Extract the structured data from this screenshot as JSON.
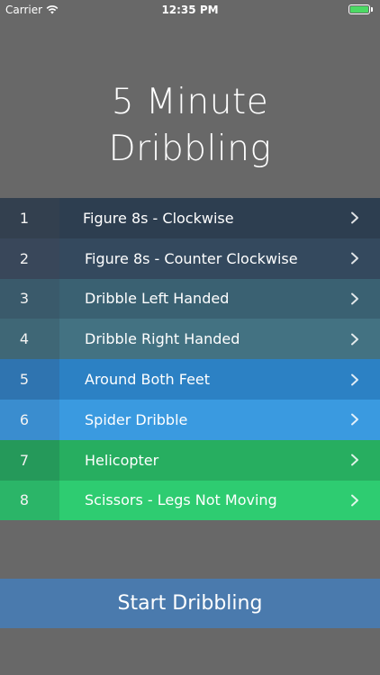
{
  "status_bar": {
    "carrier": "Carrier",
    "time": "12:35 PM",
    "battery_color": "#4cd964",
    "battery_level": 1.0
  },
  "title": {
    "line1": "5 Minute",
    "line2": "Dribbling"
  },
  "drills": [
    {
      "number": "1",
      "name": "Figure 8s - Clockwise",
      "num_bg": "#33404f",
      "row_bg": "#2d3e50"
    },
    {
      "number": "2",
      "name": "Figure 8s - Counter Clockwise",
      "num_bg": "#39475a",
      "row_bg": "#34495e"
    },
    {
      "number": "3",
      "name": "Dribble Left Handed",
      "num_bg": "#3a5a6b",
      "row_bg": "#3a6172"
    },
    {
      "number": "4",
      "name": "Dribble Right Handed",
      "num_bg": "#3f6776",
      "row_bg": "#437282"
    },
    {
      "number": "5",
      "name": "Around Both Feet",
      "num_bg": "#2f74b0",
      "row_bg": "#2c81c4"
    },
    {
      "number": "6",
      "name": "Spider Dribble",
      "num_bg": "#3a8dcf",
      "row_bg": "#3a9ae0"
    },
    {
      "number": "7",
      "name": "Helicopter",
      "num_bg": "#25995a",
      "row_bg": "#27ae60"
    },
    {
      "number": "8",
      "name": "Scissors - Legs Not Moving",
      "num_bg": "#2bb568",
      "row_bg": "#2ecc71"
    }
  ],
  "start_button": {
    "label": "Start Dribbling",
    "bg": "#4a7aad"
  },
  "colors": {
    "background": "#686868",
    "text": "#ffffff"
  }
}
